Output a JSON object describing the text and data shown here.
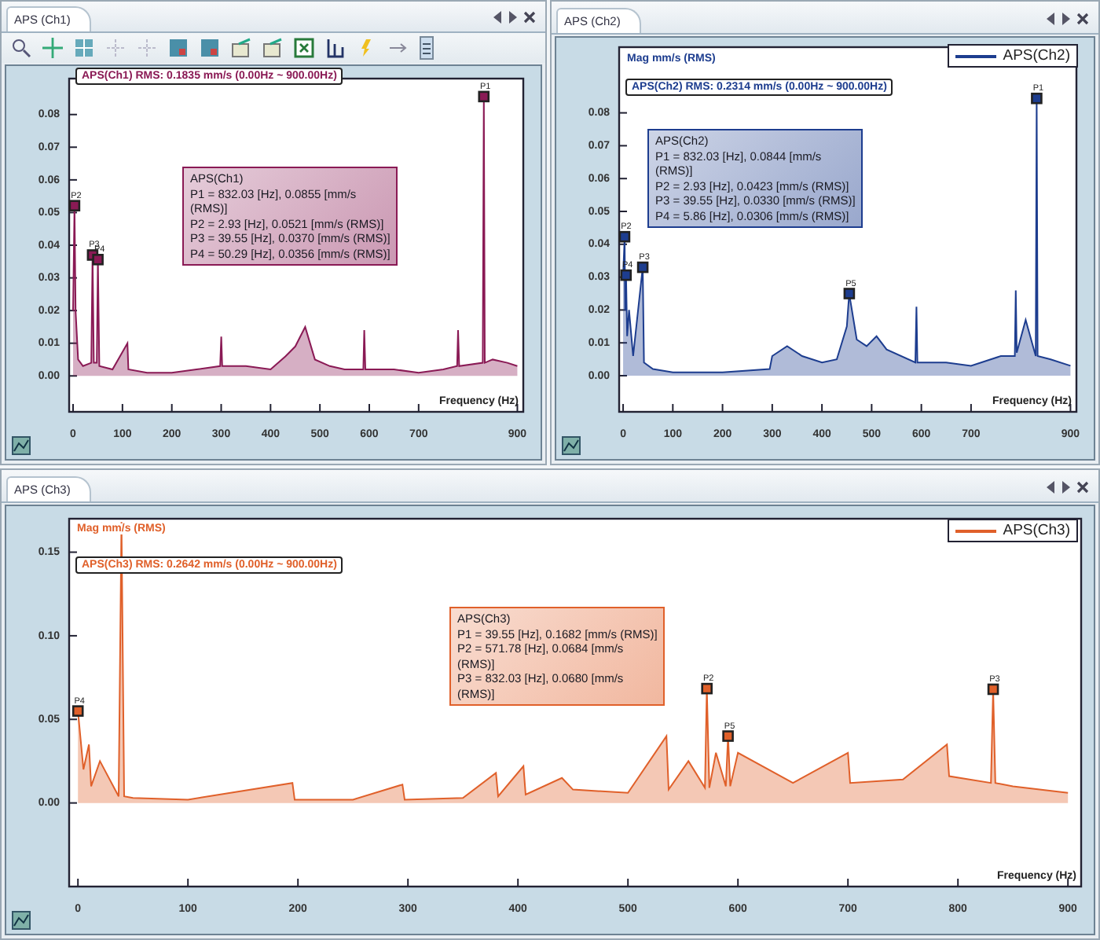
{
  "panels": [
    {
      "tab": "APS (Ch1)",
      "toolbar": true,
      "rms_label": "APS(Ch1) RMS: 0.1835 mm/s (0.00Hz ~ 900.00Hz)",
      "info_lines": [
        "APS(Ch1)",
        "P1 = 832.03 [Hz], 0.0855 [mm/s",
        "(RMS)]",
        "P2 = 2.93 [Hz], 0.0521 [mm/s (RMS)]",
        "P3 = 39.55 [Hz], 0.0370 [mm/s (RMS)]",
        "P4 = 50.29 [Hz], 0.0356 [mm/s (RMS)]"
      ],
      "chart_data": {
        "type": "area",
        "xlabel": "Frequency (Hz)",
        "xlim": [
          -8,
          912
        ],
        "ylim": [
          -0.011,
          0.091
        ],
        "xticks": [
          0,
          100,
          200,
          300,
          400,
          500,
          600,
          700,
          900
        ],
        "yticks": [
          {
            "value": 0.08,
            "label": "0.08"
          },
          {
            "value": 0.07,
            "label": "0.07"
          },
          {
            "value": 0.06,
            "label": "0.06"
          },
          {
            "value": 0.05,
            "label": "0.05"
          },
          {
            "value": 0.04,
            "label": "0.04"
          },
          {
            "value": 0.03,
            "label": "0.03"
          },
          {
            "value": 0.02,
            "label": "0.02"
          },
          {
            "value": 0.01,
            "label": "0.01"
          },
          {
            "value": 0,
            "label": "0.00"
          }
        ],
        "x": [
          0,
          2.93,
          5,
          10,
          20,
          37,
          39.55,
          42,
          48,
          50.29,
          53,
          80,
          110,
          112,
          150,
          200,
          250,
          298,
          300,
          302,
          350,
          400,
          430,
          450,
          470,
          490,
          520,
          550,
          588,
          590,
          592,
          650,
          700,
          750,
          778,
          780,
          782,
          830,
          832.03,
          834,
          850,
          880,
          900
        ],
        "series": [
          {
            "color": "#8a1a55",
            "values": [
              0.02,
              0.0521,
              0.02,
              0.005,
              0.003,
              0.004,
              0.037,
              0.004,
              0.004,
              0.0356,
              0.003,
              0.002,
              0.01,
              0.002,
              0.001,
              0.001,
              0.002,
              0.003,
              0.012,
              0.003,
              0.003,
              0.002,
              0.006,
              0.009,
              0.015,
              0.005,
              0.003,
              0.002,
              0.002,
              0.014,
              0.002,
              0.002,
              0.001,
              0.002,
              0.003,
              0.014,
              0.003,
              0.004,
              0.0855,
              0.004,
              0.005,
              0.004,
              0.003
            ]
          }
        ],
        "annotations": [
          {
            "x": 832.03,
            "y": 0.0855,
            "text": "P1"
          },
          {
            "x": 2.93,
            "y": 0.0521,
            "text": "P2"
          },
          {
            "x": 39.55,
            "y": 0.037,
            "text": "P3"
          },
          {
            "x": 50.29,
            "y": 0.0356,
            "text": "P4"
          }
        ]
      }
    },
    {
      "tab": "APS (Ch2)",
      "toolbar": false,
      "rms_label": "APS(Ch2) RMS: 0.2314 mm/s (0.00Hz ~ 900.00Hz)",
      "info_lines": [
        "APS(Ch2)",
        "P1 = 832.03 [Hz], 0.0844 [mm/s",
        "(RMS)]",
        "P2 = 2.93 [Hz], 0.0423 [mm/s (RMS)]",
        "P3 = 39.55 [Hz], 0.0330 [mm/s (RMS)]",
        "P4 = 5.86 [Hz], 0.0306 [mm/s (RMS)]"
      ],
      "chart_data": {
        "type": "area",
        "xlabel": "Frequency (Hz)",
        "ylabel": "Mag mm/s (RMS)",
        "xlim": [
          -8,
          912
        ],
        "ylim": [
          -0.011,
          0.1
        ],
        "xticks": [
          0,
          100,
          200,
          300,
          400,
          500,
          600,
          700,
          900
        ],
        "yticks": [
          {
            "value": 0.08,
            "label": "0.08"
          },
          {
            "value": 0.07,
            "label": "0.07"
          },
          {
            "value": 0.06,
            "label": "0.06"
          },
          {
            "value": 0.05,
            "label": "0.05"
          },
          {
            "value": 0.04,
            "label": "0.04"
          },
          {
            "value": 0.03,
            "label": "0.03"
          },
          {
            "value": 0.02,
            "label": "0.02"
          },
          {
            "value": 0.01,
            "label": "0.01"
          },
          {
            "value": 0,
            "label": "0.00"
          }
        ],
        "x": [
          0,
          2.93,
          4,
          5.86,
          8,
          12,
          20,
          39.55,
          42,
          60,
          100,
          200,
          295,
          300,
          330,
          360,
          400,
          430,
          450,
          455,
          470,
          490,
          510,
          530,
          588,
          590,
          592,
          650,
          700,
          760,
          788,
          790,
          792,
          810,
          830,
          832.03,
          834,
          860,
          900
        ],
        "series": [
          {
            "name": "APS(Ch2)",
            "color": "#1d3d8f",
            "values": [
              0.03,
              0.0423,
              0.02,
              0.0306,
              0.012,
              0.02,
              0.006,
              0.033,
              0.004,
              0.002,
              0.001,
              0.001,
              0.002,
              0.006,
              0.009,
              0.006,
              0.004,
              0.005,
              0.015,
              0.025,
              0.011,
              0.009,
              0.012,
              0.008,
              0.004,
              0.021,
              0.004,
              0.004,
              0.003,
              0.006,
              0.006,
              0.026,
              0.007,
              0.017,
              0.006,
              0.0844,
              0.006,
              0.005,
              0.003
            ]
          }
        ],
        "annotations": [
          {
            "x": 832.03,
            "y": 0.0844,
            "text": "P1"
          },
          {
            "x": 2.93,
            "y": 0.0423,
            "text": "P2"
          },
          {
            "x": 39.55,
            "y": 0.033,
            "text": "P3"
          },
          {
            "x": 5.86,
            "y": 0.0306,
            "text": "P4"
          },
          {
            "x": 455,
            "y": 0.025,
            "text": "P5"
          }
        ]
      }
    },
    {
      "tab": "APS (Ch3)",
      "toolbar": false,
      "rms_label": "APS(Ch3) RMS: 0.2642 mm/s (0.00Hz ~ 900.00Hz)",
      "info_lines": [
        "APS(Ch3)",
        "P1 = 39.55 [Hz], 0.1682 [mm/s (RMS)]",
        "P2 = 571.78 [Hz], 0.0684 [mm/s",
        "(RMS)]",
        "P3 = 832.03 [Hz], 0.0680 [mm/s",
        "(RMS)]"
      ],
      "chart_data": {
        "type": "area",
        "xlabel": "Frequency (Hz)",
        "ylabel": "Mag mm/s (RMS)",
        "xlim": [
          -8,
          912
        ],
        "ylim": [
          -0.05,
          0.17
        ],
        "xticks": [
          0,
          100,
          200,
          300,
          400,
          500,
          600,
          700,
          800,
          900
        ],
        "yticks": [
          {
            "value": 0.15,
            "label": "0.15"
          },
          {
            "value": 0.1,
            "label": "0.10"
          },
          {
            "value": 0.05,
            "label": "0.05"
          },
          {
            "value": 0,
            "label": "0.00"
          }
        ],
        "x": [
          0,
          5,
          10,
          12,
          20,
          37,
          39.55,
          42,
          50,
          100,
          195,
          197,
          250,
          295,
          297,
          350,
          380,
          382,
          405,
          407,
          440,
          450,
          500,
          535,
          537,
          555,
          570,
          571.78,
          574,
          580,
          589,
          591,
          593,
          600,
          650,
          700,
          702,
          750,
          790,
          792,
          830,
          832.03,
          834,
          850,
          900
        ],
        "series": [
          {
            "name": "APS(Ch3)",
            "color": "#e0602a",
            "values": [
              0.055,
              0.02,
              0.035,
              0.01,
              0.025,
              0.004,
              0.168,
              0.004,
              0.003,
              0.002,
              0.012,
              0.002,
              0.002,
              0.011,
              0.002,
              0.003,
              0.018,
              0.004,
              0.022,
              0.005,
              0.015,
              0.008,
              0.006,
              0.04,
              0.008,
              0.025,
              0.009,
              0.0684,
              0.009,
              0.03,
              0.01,
              0.04,
              0.01,
              0.03,
              0.012,
              0.03,
              0.012,
              0.014,
              0.035,
              0.016,
              0.012,
              0.068,
              0.012,
              0.01,
              0.006
            ]
          }
        ],
        "annotations": [
          {
            "x": 0,
            "y": 0.055,
            "text": "P4"
          },
          {
            "x": 571.78,
            "y": 0.0684,
            "text": "P2"
          },
          {
            "x": 591,
            "y": 0.04,
            "text": "P5"
          },
          {
            "x": 832.03,
            "y": 0.068,
            "text": "P3"
          }
        ]
      }
    }
  ]
}
